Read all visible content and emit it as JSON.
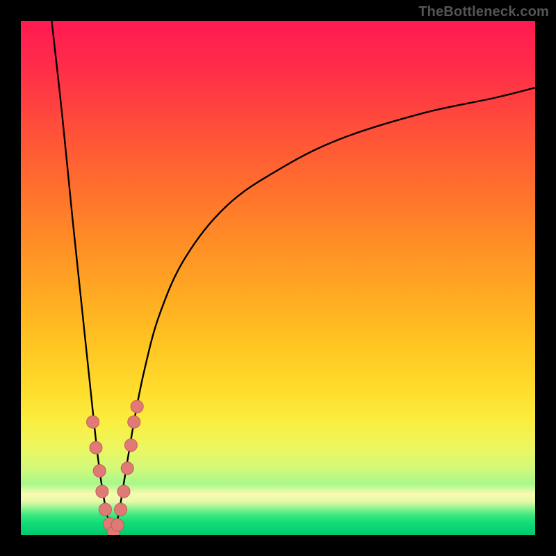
{
  "watermark": "TheBottleneck.com",
  "colors": {
    "curve_stroke": "#000000",
    "bead_fill": "#e07a76",
    "bead_stroke": "#c75a57",
    "gradient_top": "#ff1a52",
    "gradient_bottom": "#00c96e"
  },
  "chart_data": {
    "type": "line",
    "title": "",
    "xlabel": "",
    "ylabel": "",
    "xlim": [
      0,
      100
    ],
    "ylim": [
      0,
      100
    ],
    "note": "Bottleneck-percentage style curve. X is an implicit configuration axis (no ticks shown). Y is bottleneck % (0 at bottom / green, 100 at top / red). Two branches form a V with minimum (zero bottleneck) near x≈18.",
    "series": [
      {
        "name": "left-branch",
        "x": [
          6,
          8,
          10,
          12,
          14,
          15,
          16,
          17,
          18
        ],
        "y": [
          100,
          82,
          62,
          43,
          24,
          15,
          8,
          3,
          0
        ]
      },
      {
        "name": "right-branch",
        "x": [
          18,
          19,
          20,
          22,
          24,
          27,
          32,
          40,
          50,
          62,
          78,
          92,
          100
        ],
        "y": [
          0,
          4,
          10,
          22,
          32,
          43,
          54,
          64,
          71,
          77,
          82,
          85,
          87
        ]
      }
    ],
    "scatter": {
      "name": "sample-beads",
      "x": [
        14.0,
        14.6,
        15.3,
        15.8,
        16.4,
        17.2,
        18.0,
        18.8,
        19.4,
        20.0,
        20.7,
        21.4,
        22.0,
        22.6
      ],
      "y": [
        22.0,
        17.0,
        12.5,
        8.5,
        5.0,
        2.2,
        0.5,
        2.0,
        5.0,
        8.5,
        13.0,
        17.5,
        22.0,
        25.0
      ]
    }
  }
}
